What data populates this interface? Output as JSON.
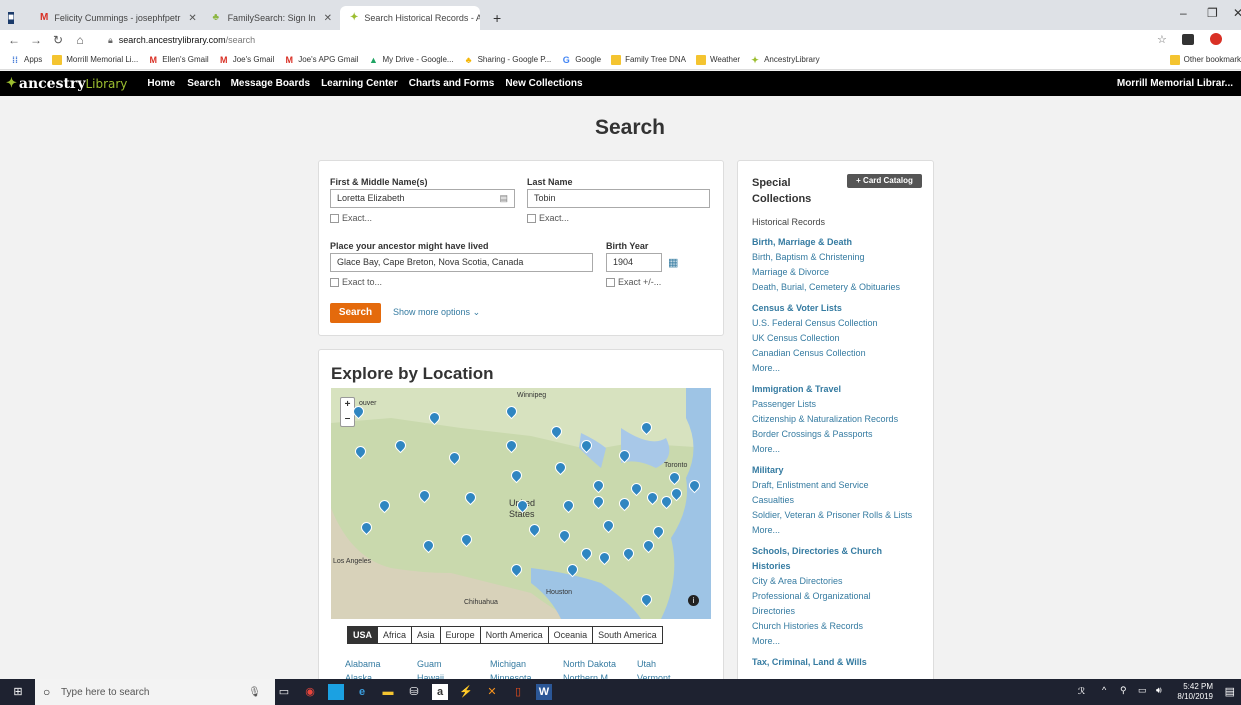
{
  "browser": {
    "tabs": [
      {
        "title": "Felicity Cummings - josephfpetr",
        "icon": "gmail-icon"
      },
      {
        "title": "FamilySearch: Sign In",
        "icon": "familysearch-icon"
      },
      {
        "title": "Search Historical Records - Ance",
        "icon": "ancestry-leaf-icon"
      }
    ],
    "new_tab": "+",
    "url_host": "search.ancestrylibrary.com",
    "url_path": "/search",
    "bookmarks": [
      "Apps",
      "Morrill Memorial Li...",
      "Ellen's Gmail",
      "Joe's Gmail",
      "Joe's APG Gmail",
      "My Drive - Google...",
      "Sharing - Google P...",
      "Google",
      "Family Tree DNA",
      "Weather",
      "AncestryLibrary"
    ],
    "other_bookmarks": "Other bookmark"
  },
  "nav": {
    "logo_main": "ancestry",
    "logo_sub": "Library",
    "items": [
      "Home",
      "Search",
      "Message Boards",
      "Learning Center",
      "Charts and Forms",
      "New Collections"
    ],
    "account": "Morrill Memorial Librar..."
  },
  "page_title": "Search",
  "form": {
    "first_label": "First & Middle Name(s)",
    "first_value": "Loretta Elizabeth",
    "last_label": "Last Name",
    "last_value": "Tobin",
    "exact": "Exact...",
    "place_label": "Place your ancestor might have lived",
    "place_value": "Glace Bay, Cape Breton, Nova Scotia, Canada",
    "place_exact": "Exact to...",
    "birth_label": "Birth Year",
    "birth_value": "1904",
    "birth_exact": "Exact +/-...",
    "search_button": "Search",
    "more_options": "Show more options"
  },
  "explore": {
    "title": "Explore by Location",
    "map_labels": [
      "Winnipeg",
      "Toronto",
      "United States",
      "Los Angeles",
      "Houston",
      "Chihuahua",
      "ouver"
    ],
    "tabs": [
      "USA",
      "Africa",
      "Asia",
      "Europe",
      "North America",
      "Oceania",
      "South America"
    ],
    "states": [
      "Alabama",
      "Alaska",
      "Guam",
      "Hawaii",
      "Michigan",
      "Minnesota",
      "North Dakota",
      "Northern M...",
      "Utah",
      "Vermont"
    ]
  },
  "special": {
    "title_line1": "Special",
    "title_line2": "Collections",
    "card_catalog": "+ Card Catalog",
    "subtitle": "Historical Records",
    "lines": [
      {
        "kind": "head",
        "text": "Birth, Marriage & Death"
      },
      {
        "kind": "link",
        "text": "Birth, Baptism & Christening"
      },
      {
        "kind": "link",
        "text": "Marriage & Divorce"
      },
      {
        "kind": "link",
        "text": "Death, Burial, Cemetery & Obituaries"
      },
      {
        "kind": "head",
        "text": "Census & Voter Lists"
      },
      {
        "kind": "link",
        "text": "U.S. Federal Census Collection"
      },
      {
        "kind": "link",
        "text": "UK Census Collection"
      },
      {
        "kind": "link",
        "text": "Canadian Census Collection"
      },
      {
        "kind": "link",
        "text": "More..."
      },
      {
        "kind": "head",
        "text": "Immigration & Travel"
      },
      {
        "kind": "link",
        "text": "Passenger Lists"
      },
      {
        "kind": "link",
        "text": "Citizenship & Naturalization Records"
      },
      {
        "kind": "link",
        "text": "Border Crossings & Passports"
      },
      {
        "kind": "link",
        "text": "More..."
      },
      {
        "kind": "head",
        "text": "Military"
      },
      {
        "kind": "link",
        "text": "Draft, Enlistment and Service"
      },
      {
        "kind": "link",
        "text": "Casualties"
      },
      {
        "kind": "link",
        "text": "Soldier, Veteran & Prisoner Rolls & Lists"
      },
      {
        "kind": "link",
        "text": "More..."
      },
      {
        "kind": "head",
        "text": "Schools, Directories & Church"
      },
      {
        "kind": "head",
        "text": "Histories"
      },
      {
        "kind": "link",
        "text": "City & Area Directories"
      },
      {
        "kind": "link",
        "text": "Professional & Organizational"
      },
      {
        "kind": "link",
        "text": "Directories"
      },
      {
        "kind": "link",
        "text": "Church Histories & Records"
      },
      {
        "kind": "link",
        "text": "More..."
      },
      {
        "kind": "head",
        "text": "Tax, Criminal, Land & Wills"
      }
    ]
  },
  "taskbar": {
    "search_placeholder": "Type here to search",
    "time": "5:42 PM",
    "date": "8/10/2019"
  }
}
